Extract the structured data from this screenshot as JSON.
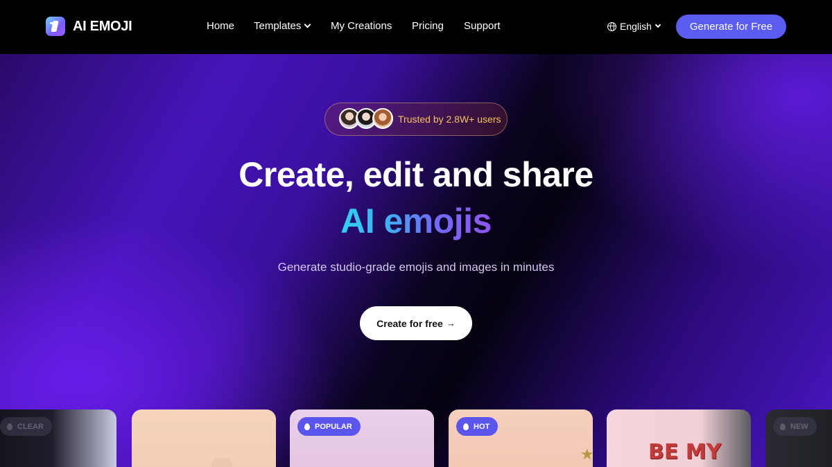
{
  "brand": {
    "name": "AI EMOJI"
  },
  "nav": {
    "items": [
      {
        "label": "Home"
      },
      {
        "label": "Templates"
      },
      {
        "label": "My Creations"
      },
      {
        "label": "Pricing"
      },
      {
        "label": "Support"
      }
    ],
    "language": "English",
    "cta": "Generate for Free"
  },
  "hero": {
    "trusted": "Trusted by 2.8W+ users",
    "title_line1": "Create, edit and share",
    "title_line2": "AI emojis",
    "subtitle": "Generate studio-grade emojis and images in minutes",
    "cta": "Create for free",
    "cta_arrow": "→"
  },
  "cards": [
    {
      "badge": "CLEAR"
    },
    {
      "badge": ""
    },
    {
      "badge": "POPULAR"
    },
    {
      "badge": "HOT"
    },
    {
      "badge": "",
      "text": "BE MY"
    },
    {
      "badge": "NEW"
    }
  ],
  "colors": {
    "accent": "#5a5cf2",
    "badge": "#5b55ee",
    "trusted_text": "#f6c35f"
  }
}
